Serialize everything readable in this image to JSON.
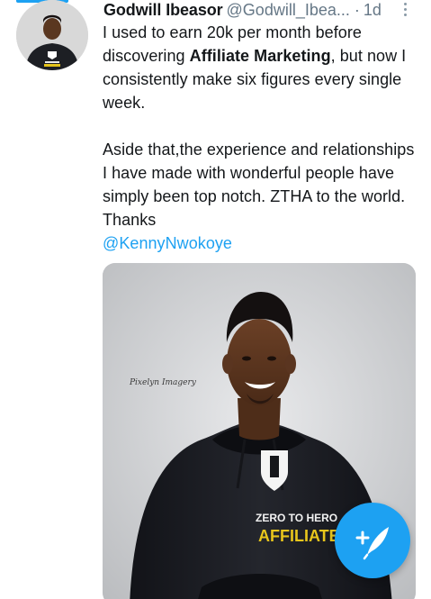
{
  "tweet": {
    "author_name": "Godwill Ibeasor",
    "handle": "@Godwill_Ibea...",
    "separator": "·",
    "time": "1d",
    "text_line_1_pre": "I used to earn 20k per month before discovering ",
    "text_line_1_bold": "Affiliate Marketing",
    "text_line_1_post": ", but now I consistently make six figures every single week.",
    "text_para_2": "Aside that,the experience and relationships I have made with wonderful people have simply been top notch. ZTHA to the world. Thanks",
    "mention": "@KennyNwokoye"
  },
  "media": {
    "photo_watermark": "Pixelyn Imagery",
    "hoodie_text_line_1": "ZERO TO HERO",
    "hoodie_text_line_2": "AFFILIATE"
  },
  "colors": {
    "accent": "#1da1f2",
    "text": "#14171a",
    "secondary_text": "#657786"
  },
  "icons": {
    "more": "more-vertical-icon",
    "compose": "compose-tweet-icon"
  }
}
